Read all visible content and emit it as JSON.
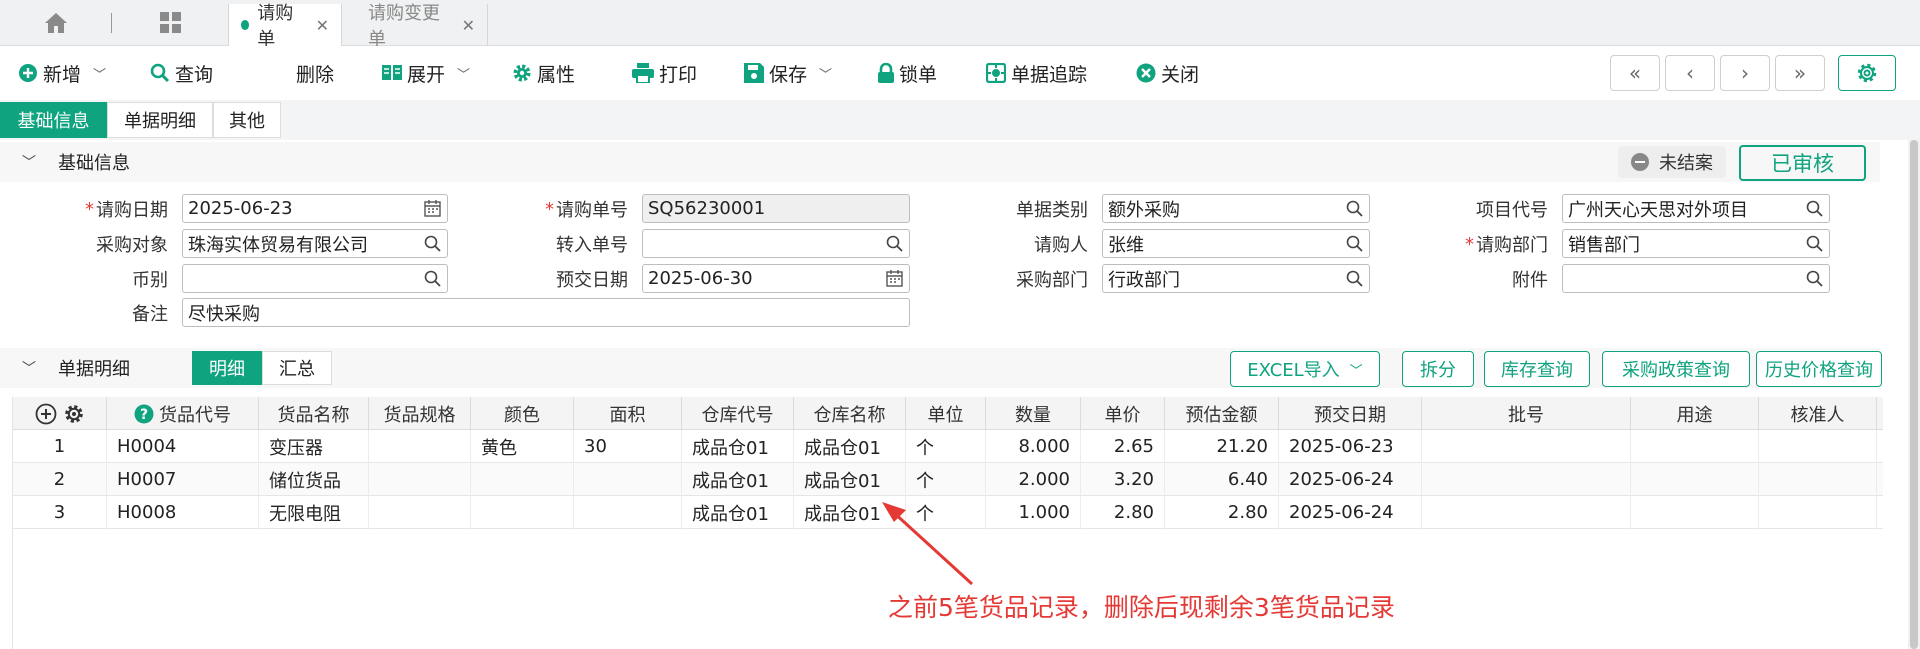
{
  "tabs": [
    {
      "label": "请购单",
      "active": true
    },
    {
      "label": "请购变更单",
      "active": false
    }
  ],
  "toolbar": {
    "new": "新增",
    "query": "查询",
    "delete": "删除",
    "expand": "展开",
    "properties": "属性",
    "print": "打印",
    "save": "保存",
    "lock": "锁单",
    "trace": "单据追踪",
    "close": "关闭"
  },
  "nav": [
    "«",
    "‹",
    "›",
    "»"
  ],
  "section_tabs": [
    "基础信息",
    "单据明细",
    "其他"
  ],
  "basic": {
    "title": "基础信息",
    "status_unclosed": "未结案",
    "status_approved": "已审核",
    "fields": {
      "request_date": {
        "label": "请购日期",
        "value": "2025-06-23"
      },
      "request_no": {
        "label": "请购单号",
        "value": "SQ56230001"
      },
      "doc_type": {
        "label": "单据类别",
        "value": "额外采购"
      },
      "project_code": {
        "label": "项目代号",
        "value": "广州天心天思对外项目"
      },
      "purchase_target": {
        "label": "采购对象",
        "value": "珠海实体贸易有限公司"
      },
      "transfer_no": {
        "label": "转入单号",
        "value": ""
      },
      "requester": {
        "label": "请购人",
        "value": "张维"
      },
      "request_dept": {
        "label": "请购部门",
        "value": "销售部门"
      },
      "currency": {
        "label": "币别",
        "value": ""
      },
      "delivery_date": {
        "label": "预交日期",
        "value": "2025-06-30"
      },
      "purchase_dept": {
        "label": "采购部门",
        "value": "行政部门"
      },
      "attachment": {
        "label": "附件",
        "value": ""
      },
      "remark": {
        "label": "备注",
        "value": "尽快采购"
      }
    }
  },
  "detail": {
    "title": "单据明细",
    "mode_detail": "明细",
    "mode_summary": "汇总",
    "buttons": {
      "excel": "EXCEL导入",
      "split": "拆分",
      "stock_query": "库存查询",
      "policy_query": "采购政策查询",
      "history_price": "历史价格查询"
    },
    "columns": [
      "货品代号",
      "货品名称",
      "货品规格",
      "颜色",
      "面积",
      "仓库代号",
      "仓库名称",
      "单位",
      "数量",
      "单价",
      "预估金额",
      "预交日期",
      "批号",
      "用途",
      "核准人"
    ],
    "rows": [
      {
        "no": "1",
        "code": "H0004",
        "name": "变压器",
        "spec": "",
        "color": "黄色",
        "area": "30",
        "wh_code": "成品仓01",
        "wh_name": "成品仓01",
        "unit": "个",
        "qty": "8.000",
        "price": "2.65",
        "amount": "21.20",
        "date": "2025-06-23",
        "batch": "",
        "usage": "",
        "approver": ""
      },
      {
        "no": "2",
        "code": "H0007",
        "name": "储位货品",
        "spec": "",
        "color": "",
        "area": "",
        "wh_code": "成品仓01",
        "wh_name": "成品仓01",
        "unit": "个",
        "qty": "2.000",
        "price": "3.20",
        "amount": "6.40",
        "date": "2025-06-24",
        "batch": "",
        "usage": "",
        "approver": ""
      },
      {
        "no": "3",
        "code": "H0008",
        "name": "无限电阻",
        "spec": "",
        "color": "",
        "area": "",
        "wh_code": "成品仓01",
        "wh_name": "成品仓01",
        "unit": "个",
        "qty": "1.000",
        "price": "2.80",
        "amount": "2.80",
        "date": "2025-06-24",
        "batch": "",
        "usage": "",
        "approver": ""
      }
    ]
  },
  "annotation": "之前5笔货品记录，删除后现剩余3笔货品记录",
  "colors": {
    "accent": "#0fa37f",
    "annotation": "#e53935",
    "required": "#e53935"
  }
}
